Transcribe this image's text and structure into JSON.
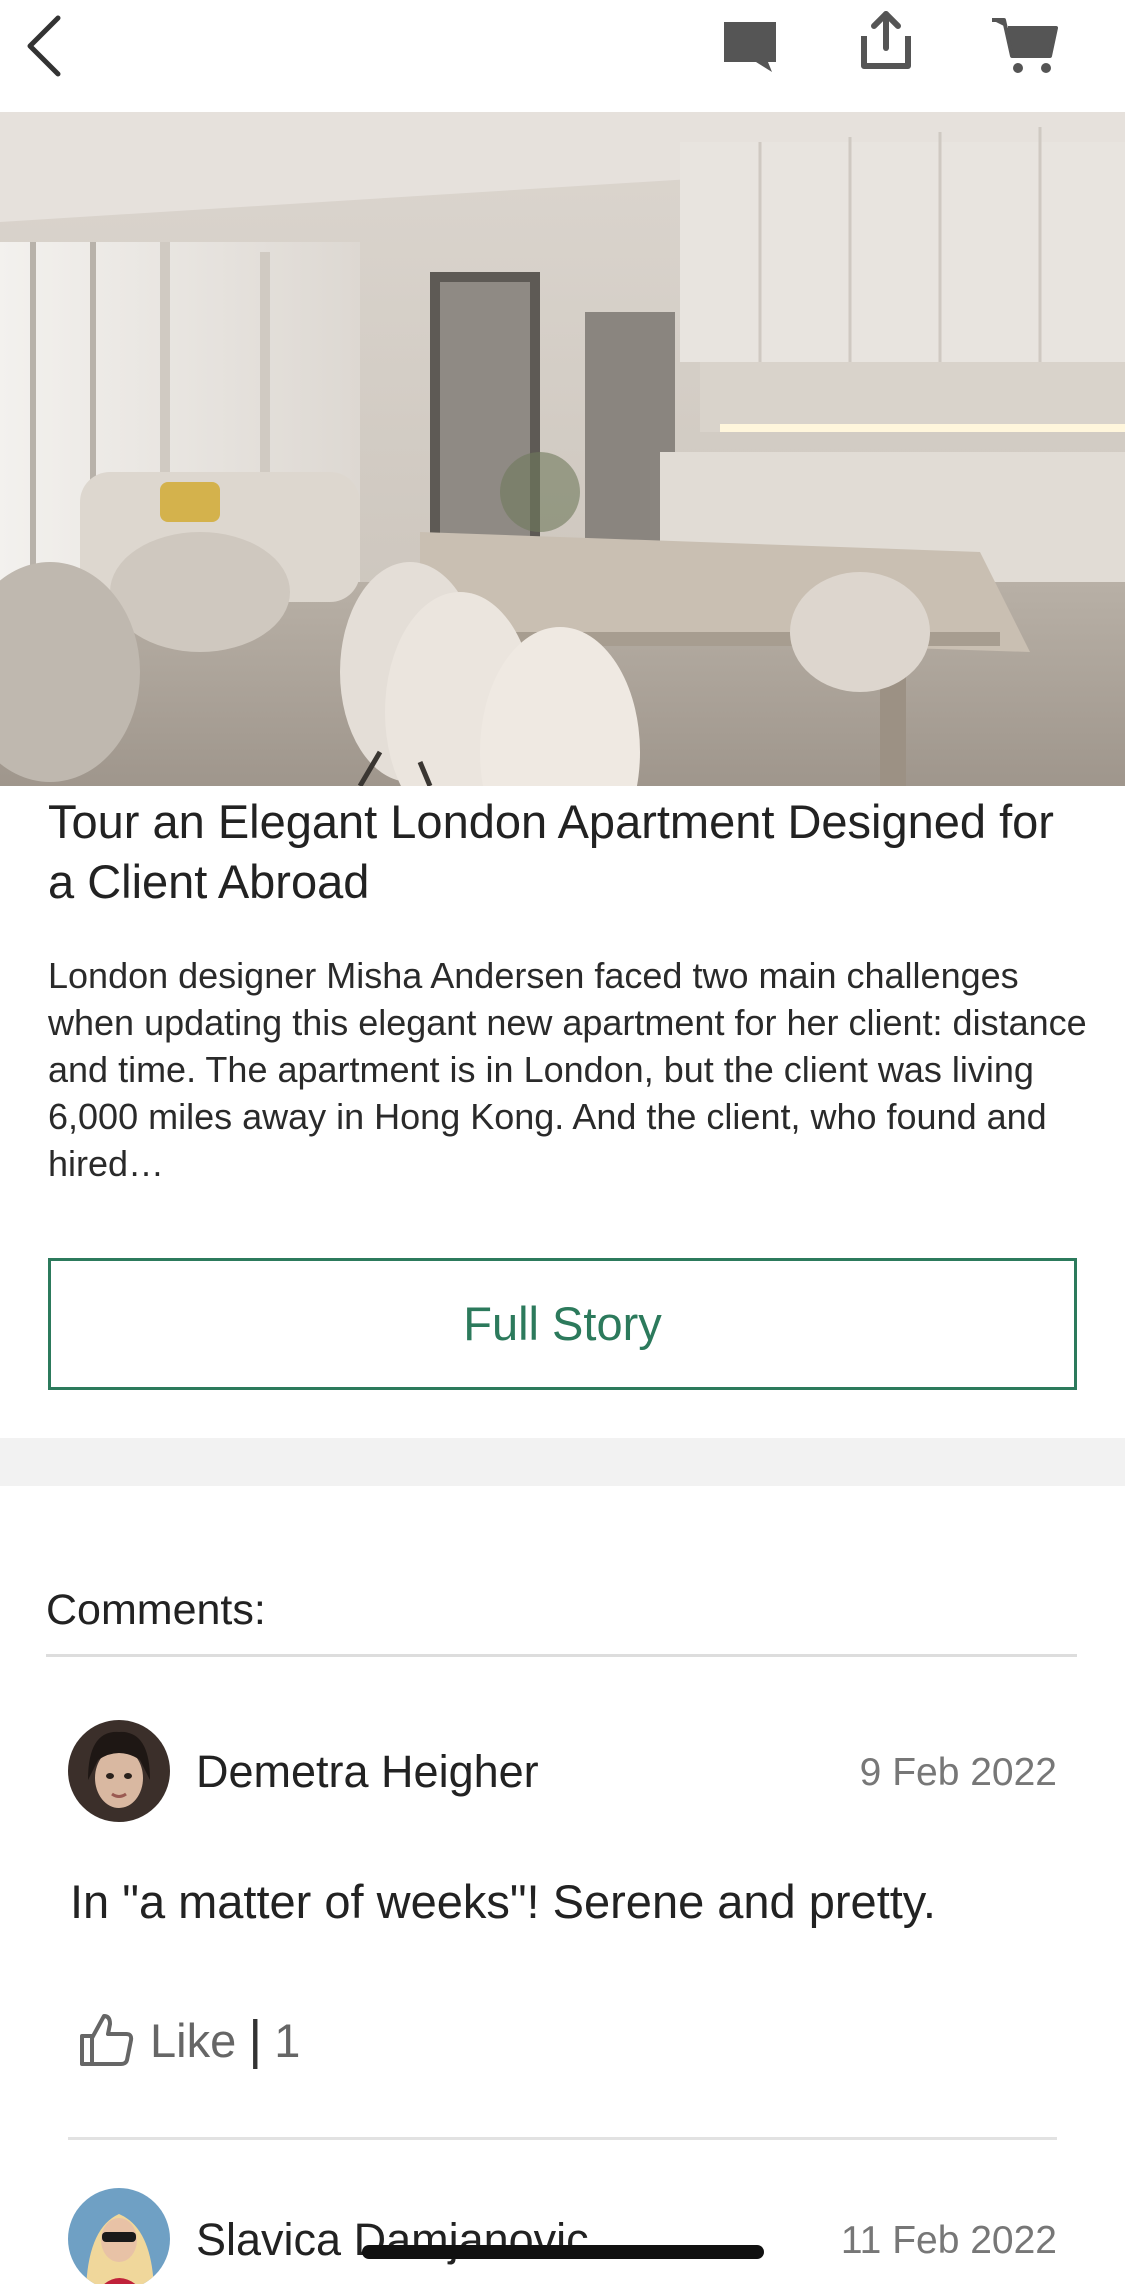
{
  "toolbar": {
    "back_icon": "chevron-left-icon",
    "chat_icon": "chat-bubble-icon",
    "share_icon": "share-icon",
    "cart_icon": "cart-icon"
  },
  "article": {
    "hero_image": "Modern open-plan kitchen and dining area with white dining chairs, long table and lounge sofa",
    "title": "Tour an Elegant London Apartment Designed for a Client Abroad",
    "summary": "London designer Misha Andersen faced two main challenges when updating this elegant new apartment for her client: distance and time. The apartment is in London, but the client was living 6,000 miles away in Hong Kong. And the client, who found and hired…",
    "full_story_label": "Full Story"
  },
  "comments": {
    "heading": "Comments:",
    "items": [
      {
        "author": "Demetra Heigher",
        "date": "9 Feb 2022",
        "text": "In \"a matter of weeks\"! Serene and pretty.",
        "like_label": "Like",
        "separator": "|",
        "like_count": "1"
      },
      {
        "author": "Slavica Damjanovic",
        "date": "11 Feb 2022"
      }
    ]
  },
  "colors": {
    "accent": "#2c7a5c",
    "band": "#f2f2f2",
    "muted_text": "#777777"
  }
}
